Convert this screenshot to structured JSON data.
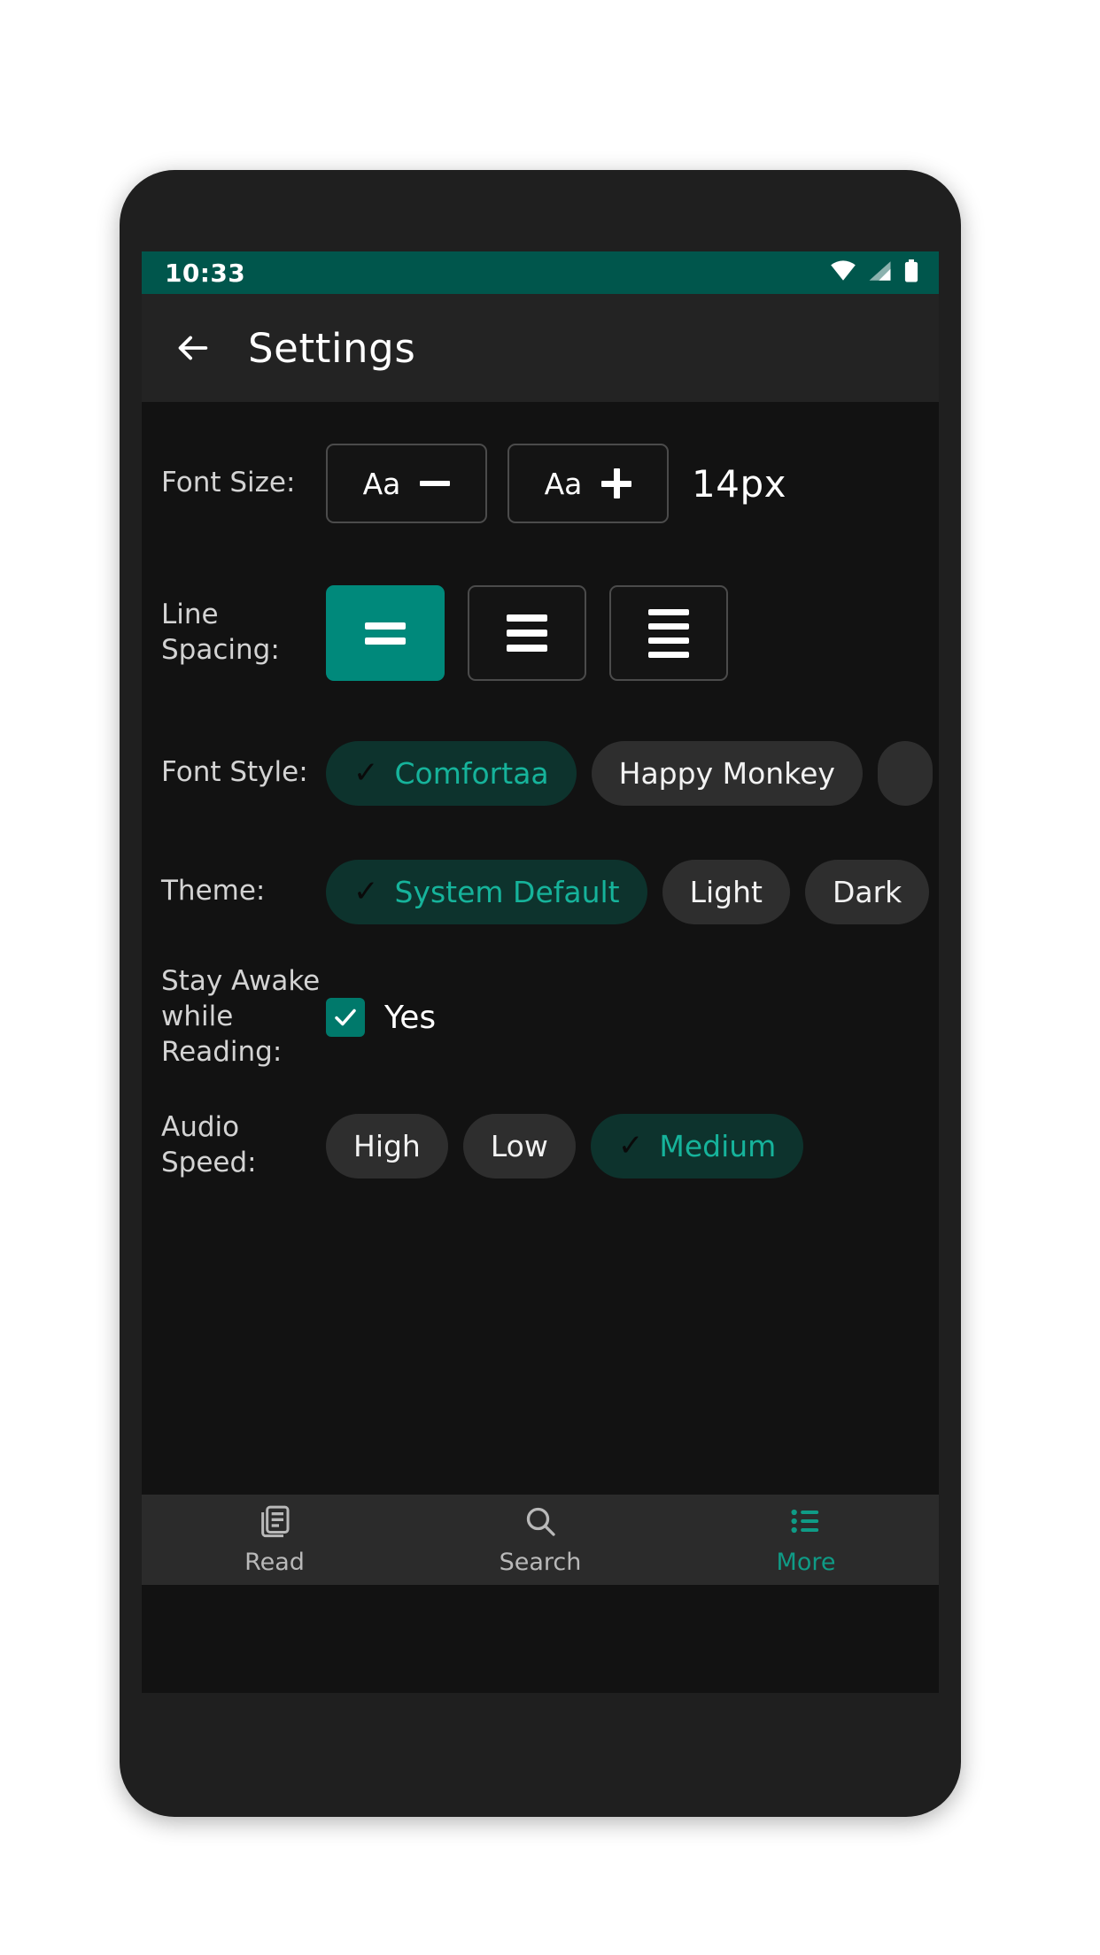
{
  "status_bar": {
    "time": "10:33",
    "icons": [
      "wifi-icon",
      "cell-signal-icon",
      "battery-icon"
    ],
    "background": "#00564C"
  },
  "app_bar": {
    "back_icon": "arrow-left-icon",
    "title": "Settings",
    "background": "#232323"
  },
  "theme_colors": {
    "accent_teal": "#00897B",
    "accent_text_teal": "#16B39B",
    "selected_chip_bg": "#0D332D",
    "chip_bg": "#2E2E2E",
    "screen_bg": "#121212",
    "nav_bg": "#2B2B2B"
  },
  "settings": {
    "font_size": {
      "label": "Font Size:",
      "decrease_label": "Aa",
      "decrease_icon": "minus-icon",
      "increase_label": "Aa",
      "increase_icon": "plus-icon",
      "value": "14px"
    },
    "line_spacing": {
      "label": "Line Spacing:",
      "options": [
        {
          "name": "spacing-small",
          "lines": 2,
          "selected": true
        },
        {
          "name": "spacing-medium",
          "lines": 3,
          "selected": false
        },
        {
          "name": "spacing-large",
          "lines": 4,
          "selected": false
        }
      ]
    },
    "font_style": {
      "label": "Font Style:",
      "options": [
        {
          "label": "Comfortaa",
          "selected": true
        },
        {
          "label": "Happy Monkey",
          "selected": false
        },
        {
          "label": "",
          "selected": false,
          "clipped": true
        }
      ]
    },
    "theme": {
      "label": "Theme:",
      "options": [
        {
          "label": "System Default",
          "selected": true
        },
        {
          "label": "Light",
          "selected": false
        },
        {
          "label": "Dark",
          "selected": false
        }
      ]
    },
    "stay_awake": {
      "label": "Stay Awake\nwhile Reading:",
      "label_line1": "Stay Awake",
      "label_line2": "while Reading:",
      "checked": true,
      "value_label": "Yes"
    },
    "audio_speed": {
      "label": "Audio Speed:",
      "options": [
        {
          "label": "High",
          "selected": false
        },
        {
          "label": "Low",
          "selected": false
        },
        {
          "label": "Medium",
          "selected": true
        }
      ]
    }
  },
  "bottom_nav": {
    "items": [
      {
        "label": "Read",
        "icon": "article-icon",
        "active": false
      },
      {
        "label": "Search",
        "icon": "search-icon",
        "active": false
      },
      {
        "label": "More",
        "icon": "list-icon",
        "active": true
      }
    ]
  },
  "check_glyph": "✓"
}
